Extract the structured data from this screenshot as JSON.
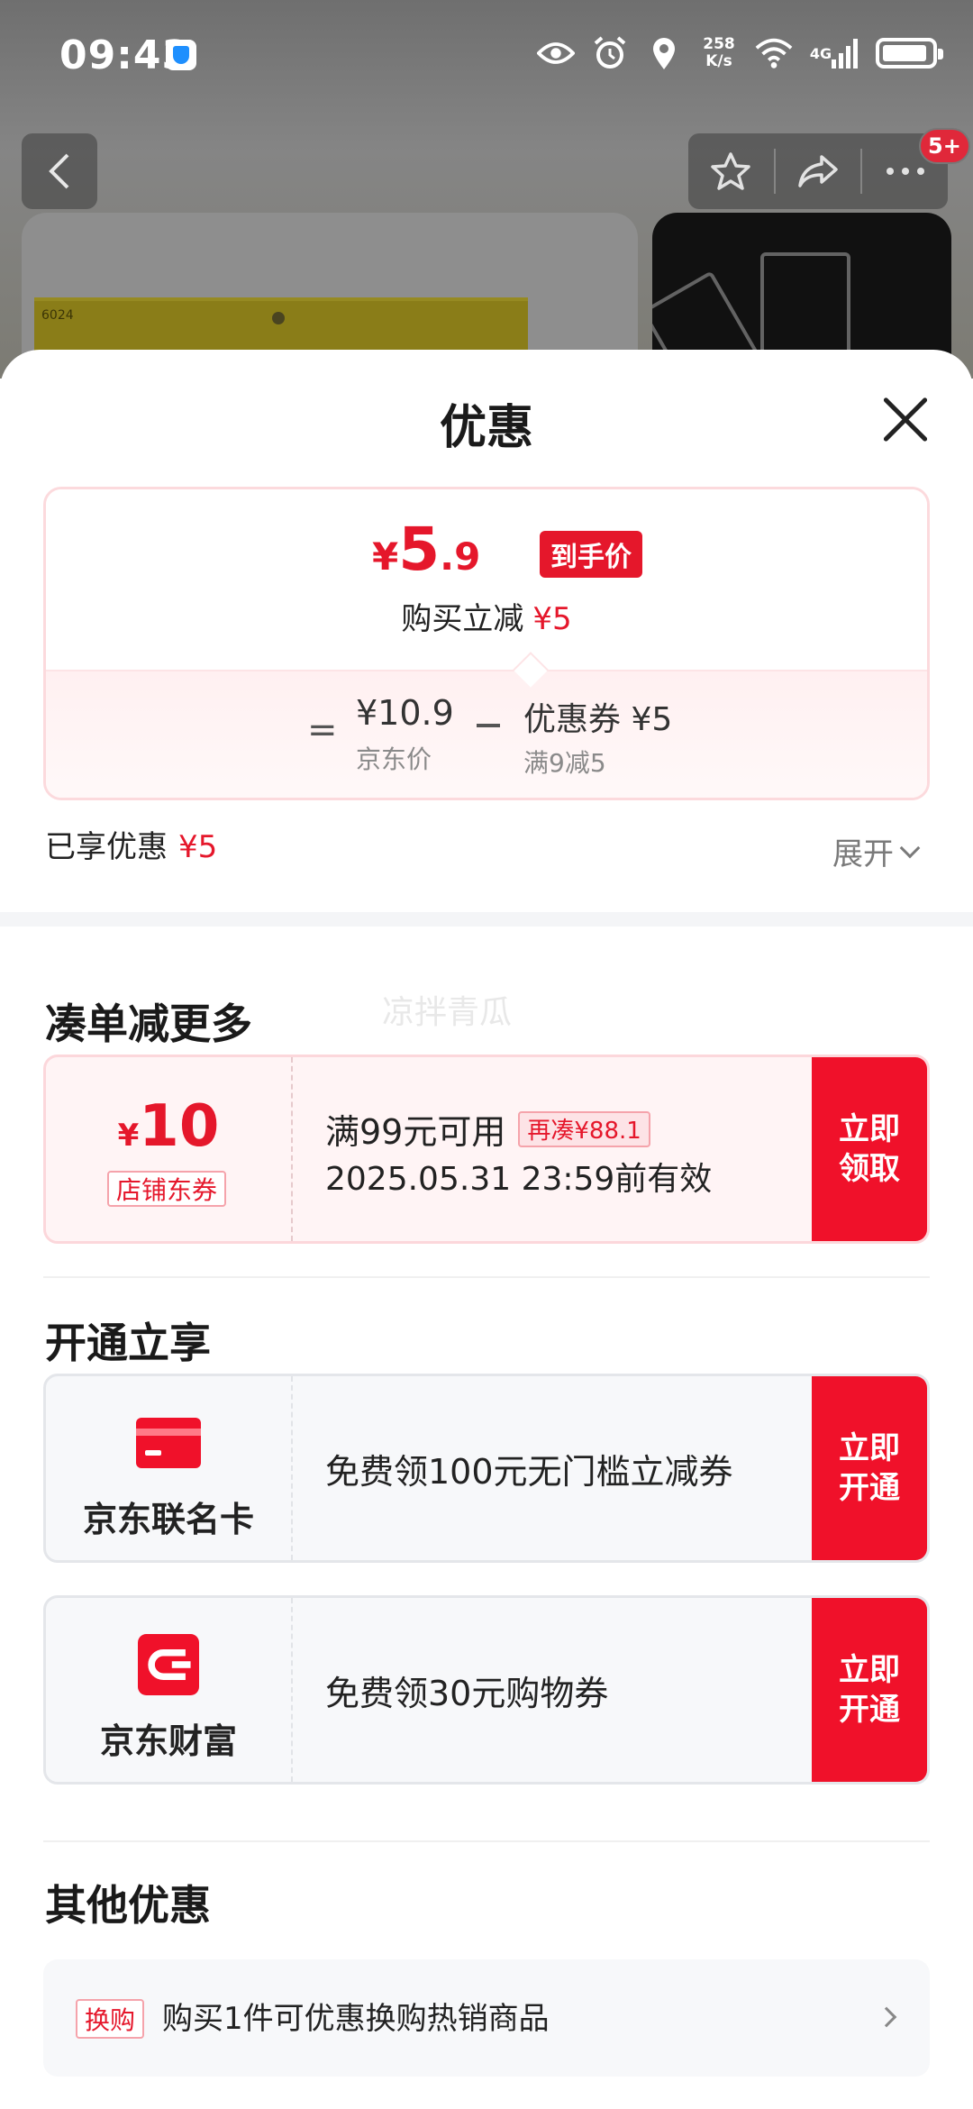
{
  "status_bar": {
    "time": "09:43",
    "net_speed_value": "258",
    "net_speed_unit": "K/s",
    "network": "4G",
    "icons": [
      "vpn-shield-icon",
      "eye-icon",
      "alarm-icon",
      "location-icon",
      "wifi-icon",
      "signal-icon",
      "battery-icon"
    ]
  },
  "product_page": {
    "cart_badge": "5+",
    "ruler_label": "6024"
  },
  "sheet": {
    "title": "优惠",
    "price_summary": {
      "final_yen": "¥",
      "final_int": "5",
      "final_dec": ".9",
      "final_tag": "到手价",
      "reduce_label": "购买立减",
      "reduce_value": "¥5",
      "equals": "=",
      "jd_price": "¥10.9",
      "jd_price_label": "京东价",
      "minus": "−",
      "coupon_price": "优惠券 ¥5",
      "coupon_condition": "满9减5"
    },
    "enjoyed": {
      "label": "已享优惠",
      "value": "¥5"
    },
    "expand_label": "展开",
    "watermark": "凉拌青瓜",
    "sections": {
      "more_title": "凑单减更多",
      "open_title": "开通立享",
      "other_title": "其他优惠"
    },
    "store_coupon": {
      "yen": "¥",
      "amount": "10",
      "type_tag": "店铺东券",
      "condition": "满99元可用",
      "add_on_tag": "再凑¥88.1",
      "validity": "2025.05.31 23:59前有效",
      "button": "立即\n领取"
    },
    "promos": [
      {
        "name": "京东联名卡",
        "icon": "credit-card-icon",
        "text": "免费领100元无门槛立减券",
        "button": "立即\n开通"
      },
      {
        "name": "京东财富",
        "icon": "jd-finance-icon",
        "text": "免费领30元购物券",
        "button": "立即\n开通"
      }
    ],
    "other": {
      "tag": "换购",
      "text": "购买1件可优惠换购热销商品"
    }
  },
  "colors": {
    "accent_red": "#f0112a",
    "price_red": "#e5172b"
  }
}
